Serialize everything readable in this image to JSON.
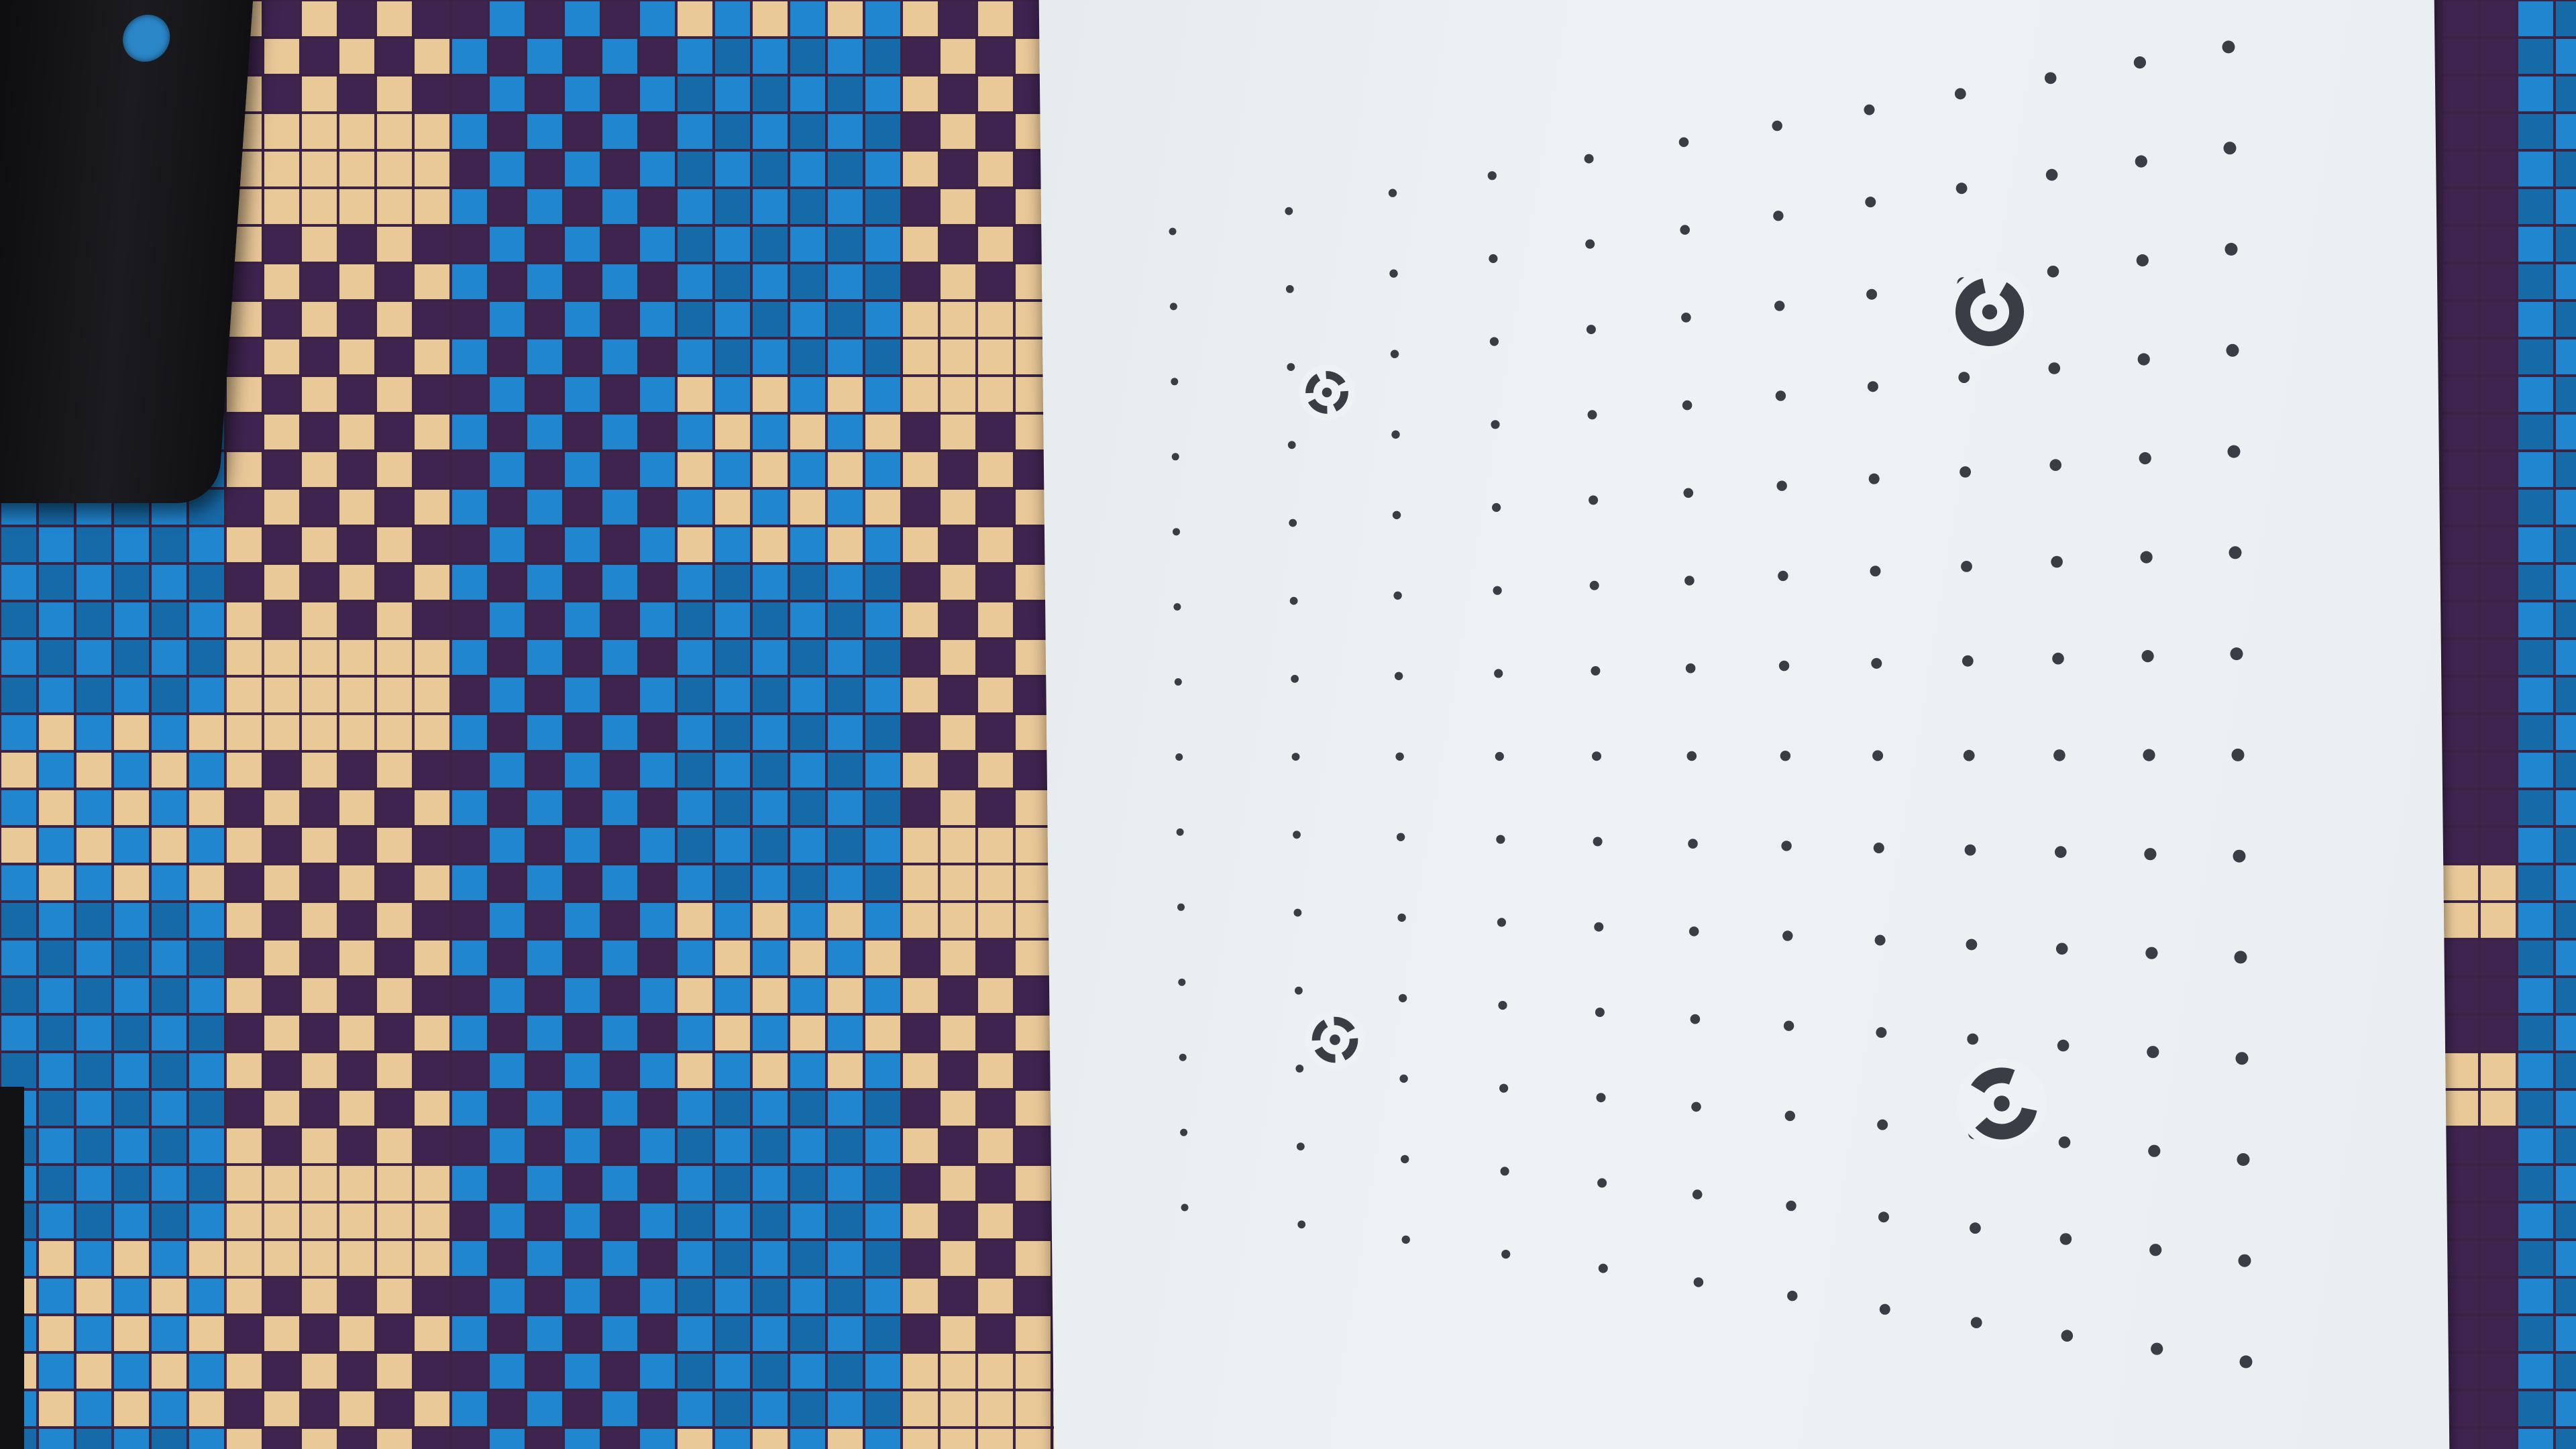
{
  "scene": {
    "description_tag": "calibration-grid-photo",
    "colors": {
      "weave_blue": "#1f86cf",
      "weave_blue_dark": "#176aa8",
      "weave_cream": "#e9c898",
      "weave_purple": "#3f2450",
      "paper": "#eaeef0",
      "dot": "#3a3d44",
      "clip": "#141417"
    },
    "dot_grid": {
      "columns": 12,
      "rows": 14
    },
    "markers": [
      {
        "name": "top-left-marker",
        "kind": "dashed-ring"
      },
      {
        "name": "top-right-marker",
        "kind": "arc-c"
      },
      {
        "name": "bottom-left-marker",
        "kind": "dashed-ring"
      },
      {
        "name": "bottom-right-marker",
        "kind": "arc-split"
      }
    ]
  }
}
